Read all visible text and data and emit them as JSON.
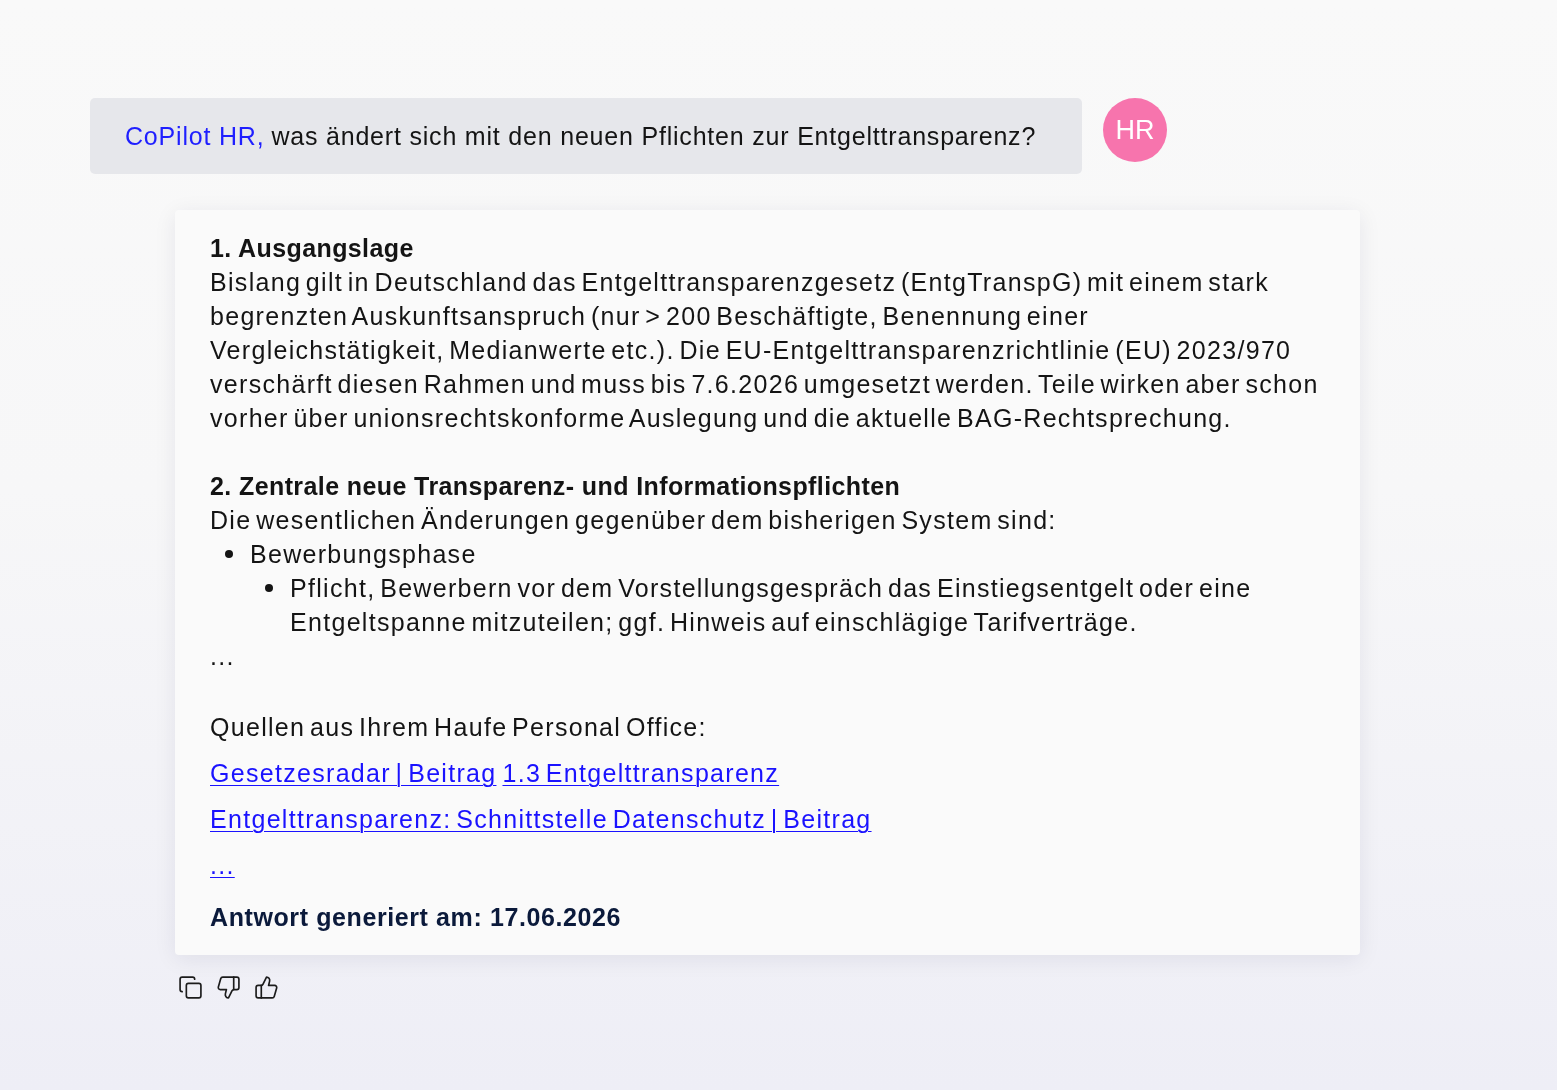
{
  "question": {
    "addressee": "CoPilot HR,",
    "text": "was ändert sich mit den neuen Pflichten zur Entgelttransparenz?"
  },
  "avatar": {
    "initials": "HR"
  },
  "answer": {
    "sections": [
      {
        "heading": "1. Ausgangslage",
        "body": "Bislang gilt in Deutschland das Entgelttransparenzgesetz (EntgTranspG) mit einem stark begrenzten Auskunftsanspruch (nur > 200 Beschäftigte, Benennung einer Vergleichstätigkeit, Medianwerte etc.). Die EU-Entgelttransparenzrichtlinie (EU) 2023/970 verschärft diesen Rahmen und muss bis 7.6.2026 umgesetzt werden. Teile wirken aber schon vorher über unionsrechtskonforme Auslegung und die aktuelle BAG-Rechtsprechung."
      },
      {
        "heading": "2. Zentrale neue Transparenz- und Informationspflichten",
        "body": "Die wesentlichen Änderungen gegenüber dem bisherigen System sind:",
        "list": [
          {
            "text": "Bewerbungsphase",
            "children": [
              {
                "text": "Pflicht, Bewerbern vor dem Vorstellungsgespräch das Einstiegsentgelt oder eine Entgeltspanne mitzuteilen; ggf. Hinweis auf einschlägige Tarifverträge."
              }
            ]
          }
        ],
        "ellipsis": "..."
      }
    ],
    "sources_label": "Quellen aus Ihrem Haufe Personal Office:",
    "sources": [
      {
        "links": [
          "Gesetzesradar | Beitrag",
          "1.3 Entgelttransparenz"
        ]
      },
      {
        "links": [
          "Entgelttransparenz: Schnittstelle Datenschutz | Beitrag"
        ]
      },
      {
        "links": [
          "..."
        ]
      }
    ],
    "generated": "Antwort generiert am: 17.06.2026"
  }
}
